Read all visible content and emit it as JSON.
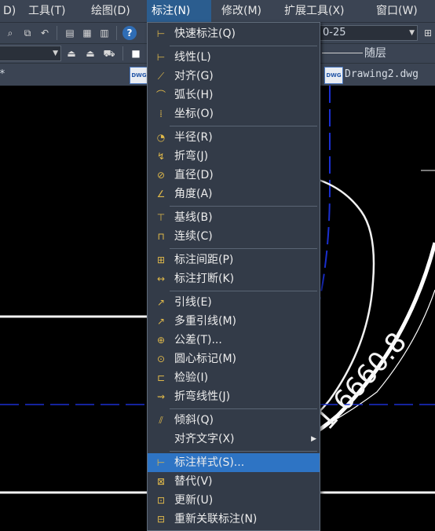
{
  "menubar": {
    "items": [
      {
        "label": "D)"
      },
      {
        "label": "工具(T)"
      },
      {
        "label": "绘图(D)"
      },
      {
        "label": "标注(N)"
      },
      {
        "label": "修改(M)"
      },
      {
        "label": "扩展工具(X)"
      },
      {
        "label": "窗口(W)"
      }
    ]
  },
  "toolbar": {
    "dimstyle_value": "0-25",
    "layer_value": "随层",
    "help_icon": "?"
  },
  "tabs": {
    "drawing2": "Drawing2.dwg",
    "left_marker": "*",
    "doc_icon_text": "DWG"
  },
  "canvas": {
    "dimension_text": "1 6660.8"
  },
  "menu": {
    "items": [
      {
        "label": "快速标注(Q)",
        "icon": "qdim-icon",
        "glyph": "⊢"
      },
      {
        "label": "线性(L)",
        "icon": "linear-dim-icon",
        "glyph": "⊢"
      },
      {
        "label": "对齐(G)",
        "icon": "aligned-dim-icon",
        "glyph": "⟋"
      },
      {
        "label": "弧长(H)",
        "icon": "arc-length-icon",
        "glyph": "⌒"
      },
      {
        "label": "坐标(O)",
        "icon": "ordinate-icon",
        "glyph": "⁞"
      },
      {
        "label": "半径(R)",
        "icon": "radius-icon",
        "glyph": "◔"
      },
      {
        "label": "折弯(J)",
        "icon": "jogged-icon",
        "glyph": "↯"
      },
      {
        "label": "直径(D)",
        "icon": "diameter-icon",
        "glyph": "⊘"
      },
      {
        "label": "角度(A)",
        "icon": "angular-icon",
        "glyph": "∠"
      },
      {
        "label": "基线(B)",
        "icon": "baseline-icon",
        "glyph": "⊤"
      },
      {
        "label": "连续(C)",
        "icon": "continue-icon",
        "glyph": "⊓"
      },
      {
        "label": "标注间距(P)",
        "icon": "dimspace-icon",
        "glyph": "⊞"
      },
      {
        "label": "标注打断(K)",
        "icon": "dimbreak-icon",
        "glyph": "↔"
      },
      {
        "label": "引线(E)",
        "icon": "leader-icon",
        "glyph": "↗"
      },
      {
        "label": "多重引线(M)",
        "icon": "mleader-icon",
        "glyph": "↗"
      },
      {
        "label": "公差(T)...",
        "icon": "tolerance-icon",
        "glyph": "⊕"
      },
      {
        "label": "圆心标记(M)",
        "icon": "center-mark-icon",
        "glyph": "⊙"
      },
      {
        "label": "检验(I)",
        "icon": "inspection-icon",
        "glyph": "⊏"
      },
      {
        "label": "折弯线性(J)",
        "icon": "jogged-linear-icon",
        "glyph": "⇝"
      },
      {
        "label": "倾斜(Q)",
        "icon": "oblique-icon",
        "glyph": "⫽"
      },
      {
        "label": "对齐文字(X)",
        "icon": "",
        "glyph": ""
      },
      {
        "label": "标注样式(S)...",
        "icon": "dimstyle-icon",
        "glyph": "⊢"
      },
      {
        "label": "替代(V)",
        "icon": "override-icon",
        "glyph": "⊠"
      },
      {
        "label": "更新(U)",
        "icon": "update-icon",
        "glyph": "⊡"
      },
      {
        "label": "重新关联标注(N)",
        "icon": "reassociate-icon",
        "glyph": "⊟"
      }
    ]
  },
  "colors": {
    "menubar_bg": "#3b4453",
    "menu_bg": "#333b48",
    "highlight": "#2e74c4",
    "icon_accent": "#e0b94a",
    "dashed_line": "#1a2fd0"
  }
}
